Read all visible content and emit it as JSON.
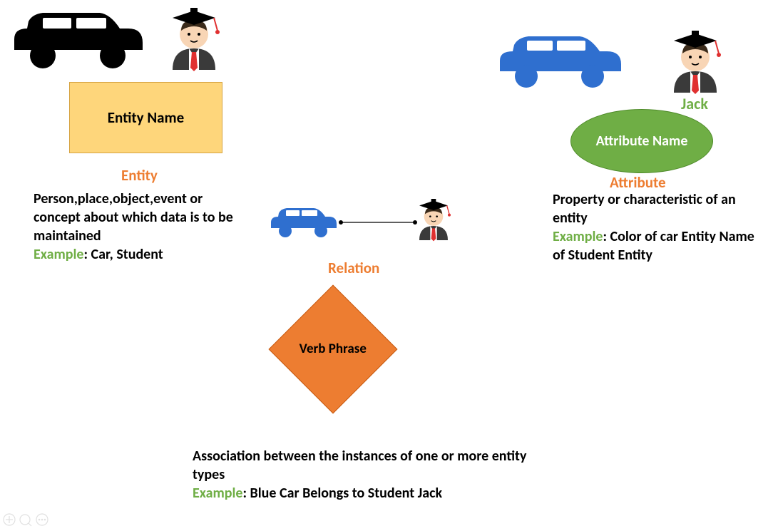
{
  "entity": {
    "shape_label": "Entity Name",
    "label": "Entity",
    "description": "Person,place,object,event or concept about which data is to be maintained",
    "example_prefix": "Example",
    "example_text": ": Car, Student"
  },
  "attribute": {
    "shape_label": "Attribute Name",
    "label": "Attribute",
    "jack_label": "Jack",
    "description": "Property or characteristic of an entity",
    "example_prefix": "Example",
    "example_text": ": Color of car Entity Name of Student Entity"
  },
  "relation": {
    "shape_label": "Verb Phrase",
    "label": "Relation",
    "description": "Association between the instances of one or more entity types",
    "example_prefix": "Example",
    "example_text": ": Blue Car Belongs to Student Jack"
  }
}
